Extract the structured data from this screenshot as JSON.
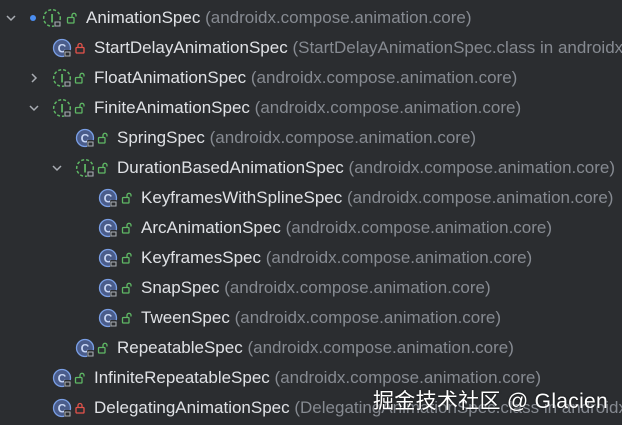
{
  "colors": {
    "background": "#2b2d30",
    "text": "#dfe1e5",
    "package_text": "#868a91",
    "abstract_icon_green": "#5fb865",
    "class_icon_blue": "#7a9fe6",
    "lock_red": "#e5534b",
    "visibility_green": "#5fb865",
    "dot_blue": "#4b8ef0"
  },
  "tree": {
    "items": [
      {
        "name": "AnimationSpec",
        "package": "(androidx.compose.animation.core)",
        "icon": "abstract-interface-icon",
        "badge": "open-lock-icon",
        "expander": "chevron-down-icon",
        "dot": true
      },
      {
        "name": "StartDelayAnimationSpec",
        "package": "(StartDelayAnimationSpec.class in androidx",
        "icon": "class-icon",
        "badge": "private-lock-icon",
        "expander": null
      },
      {
        "name": "FloatAnimationSpec",
        "package": "(androidx.compose.animation.core)",
        "icon": "abstract-interface-icon",
        "badge": "open-lock-icon",
        "expander": "chevron-right-icon"
      },
      {
        "name": "FiniteAnimationSpec",
        "package": "(androidx.compose.animation.core)",
        "icon": "abstract-interface-icon",
        "badge": "open-lock-icon",
        "expander": "chevron-down-icon"
      },
      {
        "name": "SpringSpec",
        "package": "(androidx.compose.animation.core)",
        "icon": "class-icon",
        "badge": "open-lock-icon",
        "expander": null
      },
      {
        "name": "DurationBasedAnimationSpec",
        "package": "(androidx.compose.animation.core)",
        "icon": "abstract-interface-icon",
        "badge": "open-lock-icon",
        "expander": "chevron-down-icon"
      },
      {
        "name": "KeyframesWithSplineSpec",
        "package": "(androidx.compose.animation.core)",
        "icon": "class-icon",
        "badge": "open-lock-icon",
        "expander": null
      },
      {
        "name": "ArcAnimationSpec",
        "package": "(androidx.compose.animation.core)",
        "icon": "class-icon",
        "badge": "open-lock-icon",
        "expander": null
      },
      {
        "name": "KeyframesSpec",
        "package": "(androidx.compose.animation.core)",
        "icon": "class-icon",
        "badge": "open-lock-icon",
        "expander": null
      },
      {
        "name": "SnapSpec",
        "package": "(androidx.compose.animation.core)",
        "icon": "class-icon",
        "badge": "open-lock-icon",
        "expander": null
      },
      {
        "name": "TweenSpec",
        "package": "(androidx.compose.animation.core)",
        "icon": "class-icon",
        "badge": "open-lock-icon",
        "expander": null
      },
      {
        "name": "RepeatableSpec",
        "package": "(androidx.compose.animation.core)",
        "icon": "class-icon",
        "badge": "open-lock-icon",
        "expander": null
      },
      {
        "name": "InfiniteRepeatableSpec",
        "package": "(androidx.compose.animation.core)",
        "icon": "class-icon",
        "badge": "open-lock-icon",
        "expander": null
      },
      {
        "name": "DelegatingAnimationSpec",
        "package": "(DelegatingAnimationSpec.class in androidx",
        "icon": "class-icon",
        "badge": "private-lock-icon",
        "expander": null
      }
    ]
  },
  "watermark": "掘金技术社区 @ Glacien"
}
